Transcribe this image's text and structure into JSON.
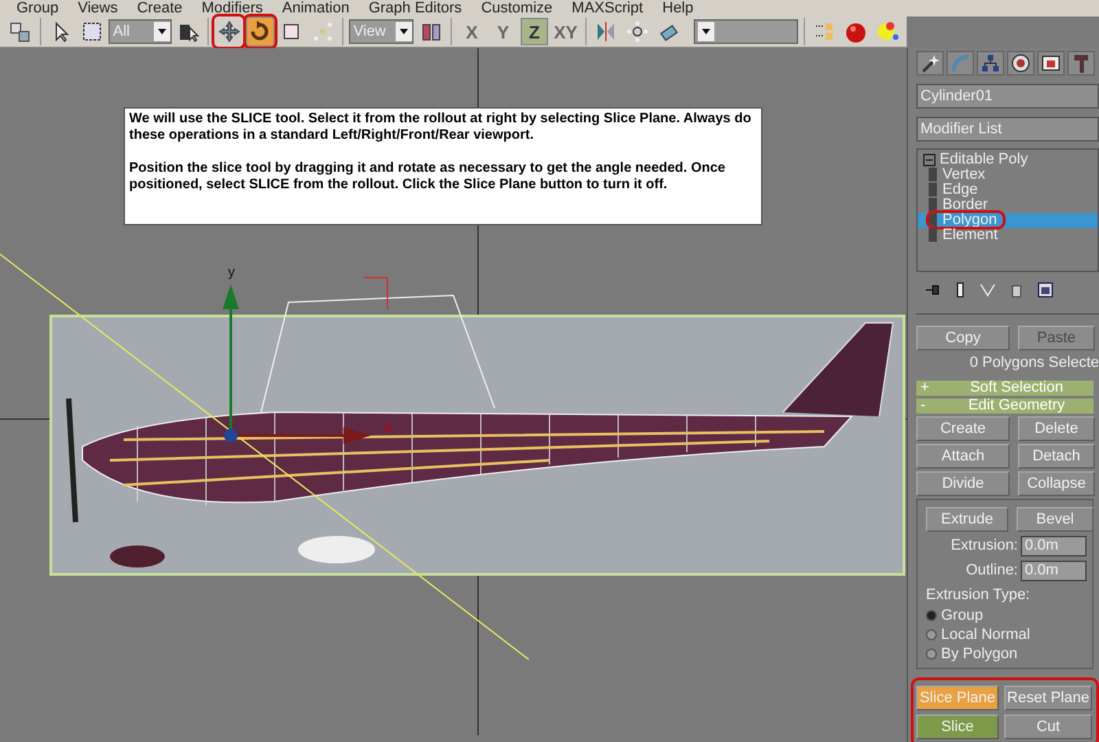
{
  "menu_bar": [
    "Group",
    "Views",
    "Create",
    "Modifiers",
    "Animation",
    "Graph Editors",
    "Customize",
    "MAXScript",
    "Help"
  ],
  "toolbar": {
    "selection_filter": "All",
    "move_tool": {
      "selected": false,
      "highlighted": true
    },
    "rotate_tool": {
      "selected": true,
      "highlighted": true
    },
    "reference_coordinate": "View",
    "axis_constraints": [
      {
        "label": "X",
        "selected": false
      },
      {
        "label": "Y",
        "selected": false
      },
      {
        "label": "Z",
        "selected": true
      },
      {
        "label": "XY",
        "selected": false
      }
    ]
  },
  "viewport": {
    "note": [
      "We will use the SLICE tool.  Select it from the rollout at right by selecting Slice Plane.  Always do these operations in a standard Left/Right/Front/Rear viewport.",
      "Position the slice tool by dragging it and rotate as necessary to get the angle needed.  Once positioned, select SLICE from the rollout.  Click the Slice Plane button to turn it off."
    ],
    "gizmo_y_label": "y",
    "gizmo_x_label": "x"
  },
  "command_panel": {
    "object_name": "Cylinder01",
    "modifier_list": "Modifier List",
    "stack": [
      {
        "label": "Editable Poly",
        "expanded": true,
        "children": [
          {
            "label": "Vertex",
            "selected": false,
            "highlighted": false
          },
          {
            "label": "Edge",
            "selected": false,
            "highlighted": false
          },
          {
            "label": "Border",
            "selected": false,
            "highlighted": false
          },
          {
            "label": "Polygon",
            "selected": true,
            "highlighted": true
          },
          {
            "label": "Element",
            "selected": false,
            "highlighted": false
          }
        ]
      }
    ],
    "selection_buttons": [
      {
        "label": "Copy",
        "disabled": false
      },
      {
        "label": "Paste",
        "disabled": true
      }
    ],
    "selection_status": "0 Polygons Selecte",
    "rollouts": [
      {
        "toggle": "+",
        "label": "Soft Selection"
      },
      {
        "toggle": "-",
        "label": "Edit Geometry"
      }
    ],
    "edit_buttons": [
      "Create",
      "Delete",
      "Attach",
      "Detach",
      "Divide",
      "Collapse"
    ],
    "polygon_buttons": [
      "Extrude",
      "Bevel"
    ],
    "fields": [
      {
        "label": "Extrusion:",
        "value": "0.0m"
      },
      {
        "label": "Outline:",
        "value": "0.0m"
      }
    ],
    "extrusion_type": {
      "label": "Extrusion Type:",
      "options": [
        {
          "label": "Group",
          "selected": true
        },
        {
          "label": "Local Normal",
          "selected": false
        },
        {
          "label": "By Polygon",
          "selected": false
        }
      ]
    },
    "slice_highlighted": true,
    "slice_buttons": [
      {
        "label": "Slice Plane",
        "kind": "active"
      },
      {
        "label": "Reset Plane",
        "kind": "plain"
      },
      {
        "label": "Slice",
        "kind": "accent"
      },
      {
        "label": "Cut",
        "kind": "plain"
      }
    ]
  }
}
